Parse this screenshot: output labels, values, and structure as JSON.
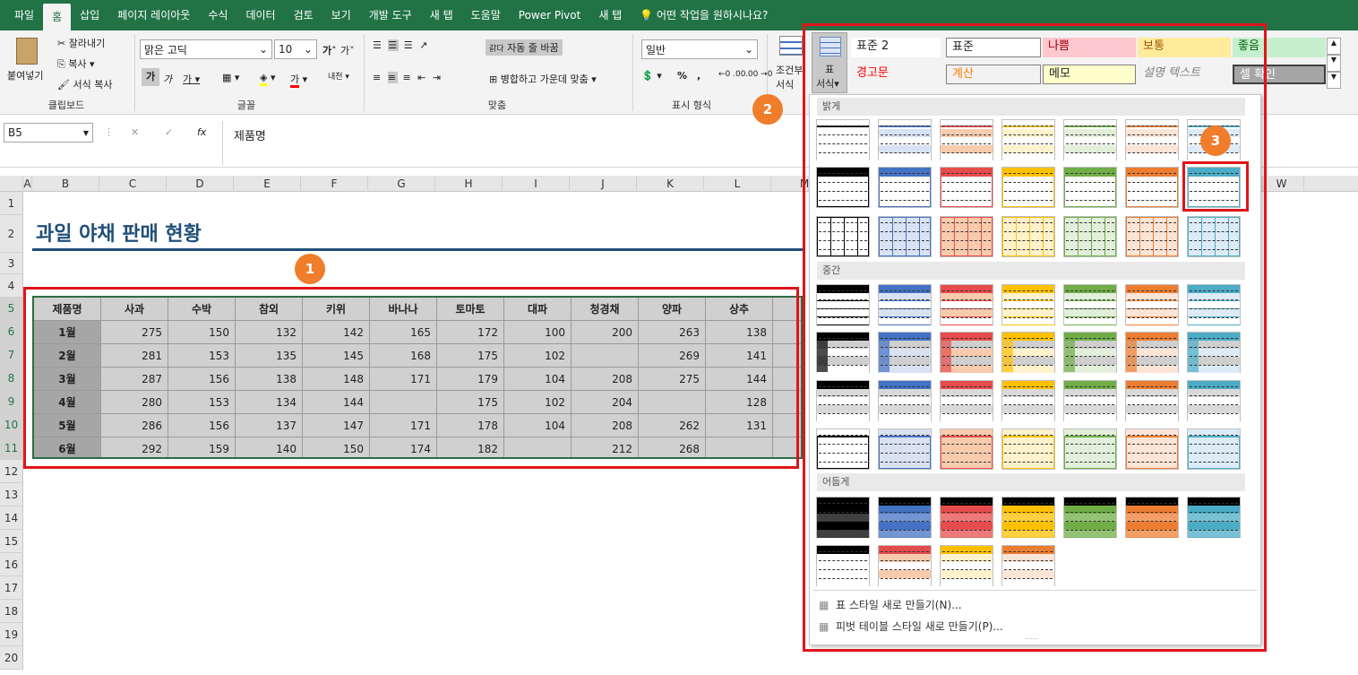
{
  "menu": {
    "tabs": [
      "파일",
      "홈",
      "삽입",
      "페이지 레이아웃",
      "수식",
      "데이터",
      "검토",
      "보기",
      "개발 도구",
      "새 탭",
      "도움말",
      "Power Pivot",
      "새 탭"
    ],
    "active_index": 1,
    "tell_me": "어떤 작업을 원하시나요?"
  },
  "ribbon": {
    "clipboard": {
      "paste": "붙여넣기",
      "cut": "잘라내기",
      "copy": "복사",
      "format_painter": "서식 복사",
      "label": "클립보드"
    },
    "font": {
      "name": "맑은 고딕",
      "size": "10",
      "bold": "가",
      "italic": "가",
      "underline": "가",
      "grow": "가",
      "shrink": "가",
      "color_a": "가",
      "phonetic": "내천",
      "label": "글꼴"
    },
    "alignment": {
      "wrap_text": "자동 줄 바꿈",
      "merge": "병합하고 가운데 맞춤",
      "label": "맞춤",
      "wrap_prefix": "갉다"
    },
    "number": {
      "format": "일반",
      "percent": "%",
      "comma": ",",
      "label": "표시 형식"
    },
    "styles": {
      "conditional": "조건부",
      "conditional2": "서식",
      "table_format_top": "표",
      "table_format_bottom": "서식",
      "cells": [
        {
          "label": "표준 2",
          "color": "#ffffff",
          "text": "#222222"
        },
        {
          "label": "표준",
          "color": "#ffffff",
          "text": "#222222"
        },
        {
          "label": "나쁨",
          "color": "#ffc7ce",
          "text": "#9c0006"
        },
        {
          "label": "보통",
          "color": "#ffeb9c",
          "text": "#9c5700"
        },
        {
          "label": "좋음",
          "color": "#c6efce",
          "text": "#006100"
        },
        {
          "label": "경고문",
          "color": "#f3f3f3",
          "text": "#ff0000"
        },
        {
          "label": "계산",
          "color": "#f2f2f2",
          "text": "#fa7d00"
        },
        {
          "label": "메모",
          "color": "#ffffcc",
          "text": "#222222"
        },
        {
          "label": "설명 텍스트",
          "color": "#f3f3f3",
          "text": "#7f7f7f"
        },
        {
          "label": "셀 확인",
          "color": "#a5a5a5",
          "text": "#ffffff"
        }
      ]
    }
  },
  "formula_bar": {
    "name_box": "B5",
    "fx": "fx",
    "value": "제품명"
  },
  "columns": [
    "A",
    "B",
    "C",
    "D",
    "E",
    "F",
    "G",
    "H",
    "I",
    "J",
    "K",
    "L",
    "M",
    "W"
  ],
  "rows": [
    "1",
    "2",
    "3",
    "4",
    "5",
    "6",
    "7",
    "8",
    "9",
    "10",
    "11",
    "12",
    "13",
    "14",
    "15",
    "16",
    "17",
    "18",
    "19",
    "20"
  ],
  "sheet": {
    "title": "과일 야채 판매 현황",
    "headers": [
      "제품명",
      "사과",
      "수박",
      "참외",
      "키위",
      "바나나",
      "토마토",
      "대파",
      "청경채",
      "양파",
      "상추",
      "채"
    ],
    "rows": [
      [
        "1월",
        "275",
        "150",
        "132",
        "142",
        "165",
        "172",
        "100",
        "200",
        "263",
        "138"
      ],
      [
        "2월",
        "281",
        "153",
        "135",
        "145",
        "168",
        "175",
        "102",
        "",
        "269",
        "141"
      ],
      [
        "3월",
        "287",
        "156",
        "138",
        "148",
        "171",
        "179",
        "104",
        "208",
        "275",
        "144"
      ],
      [
        "4월",
        "280",
        "153",
        "134",
        "144",
        "",
        "175",
        "102",
        "204",
        "",
        "128"
      ],
      [
        "5월",
        "286",
        "156",
        "137",
        "147",
        "171",
        "178",
        "104",
        "208",
        "262",
        "131"
      ],
      [
        "6월",
        "292",
        "159",
        "140",
        "150",
        "174",
        "182",
        "",
        "212",
        "268",
        ""
      ]
    ]
  },
  "gallery": {
    "sections": [
      "밝게",
      "중간",
      "어둡게"
    ],
    "colors": [
      "#000000",
      "#4472c4",
      "#e74c4c",
      "#ffc000",
      "#70ad47",
      "#ed7d31",
      "#4bacc6"
    ],
    "light_tints": [
      "#ffffff",
      "#d9e2f3",
      "#f8cbad",
      "#fff2cc",
      "#e2efda",
      "#fce4d6",
      "#ddebf7"
    ],
    "new_table_style": "표 스타일 새로 만들기(N)...",
    "new_pivot_style": "피벗 테이블 스타일 새로 만들기(P)...",
    "more": "....."
  },
  "badges": [
    "1",
    "2",
    "3"
  ]
}
